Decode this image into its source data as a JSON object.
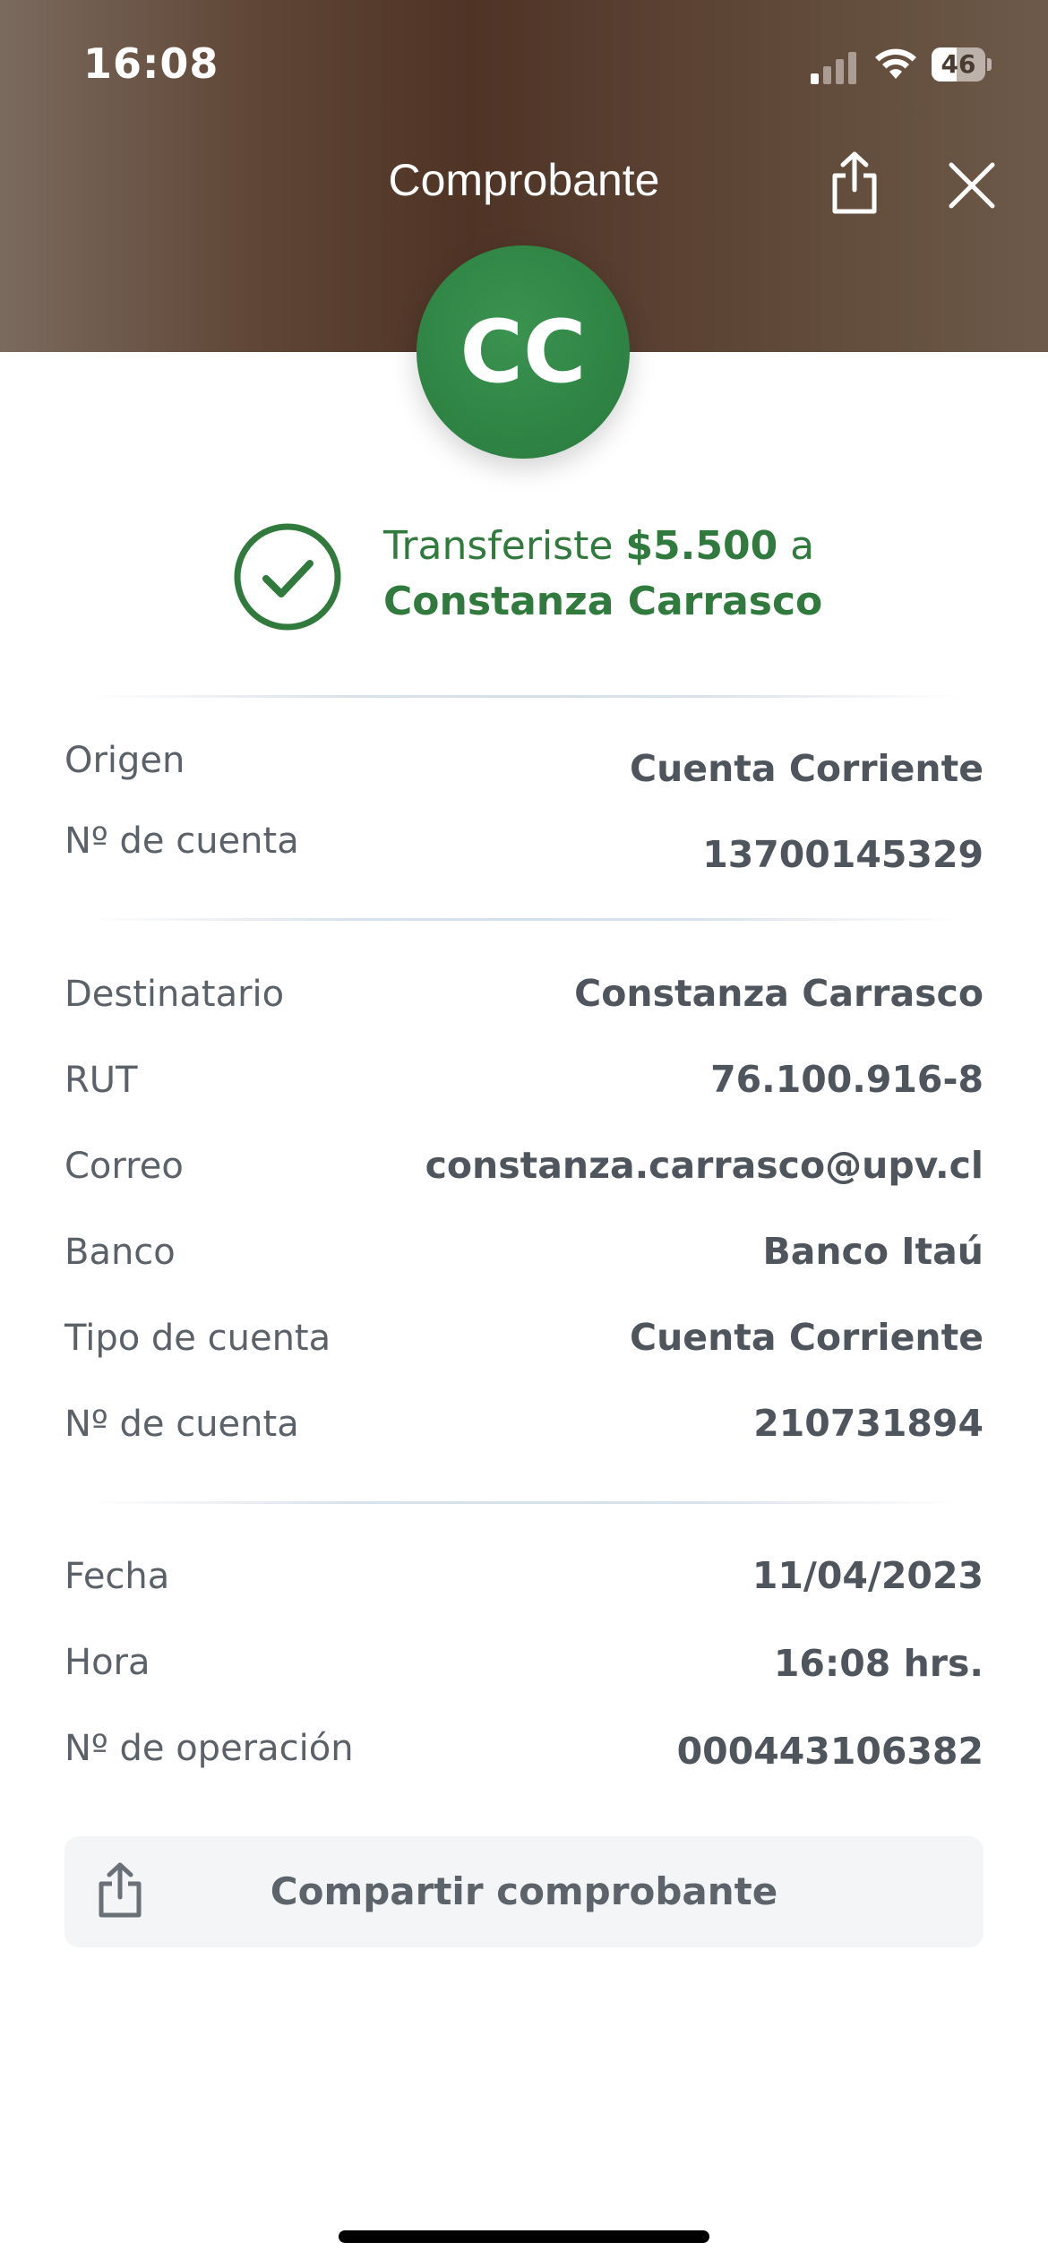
{
  "status_bar": {
    "time": "16:08",
    "battery_level": "46",
    "signal_bars_active": 1,
    "signal_bars_total": 4
  },
  "header": {
    "title": "Comprobante",
    "share_icon": "share-icon",
    "close_icon": "close-icon"
  },
  "avatar": {
    "initials": "CC",
    "color": "#2f8444"
  },
  "success": {
    "prefix": "Transferiste ",
    "amount": "$5.500",
    "suffix": " a",
    "recipient": "Constanza Carrasco",
    "icon": "check-circle-icon",
    "color": "#2f7a3c"
  },
  "origin": {
    "origen_label": "Origen",
    "origen_value": "Cuenta Corriente",
    "cuenta_label": "Nº de cuenta",
    "cuenta_value": "13700145329"
  },
  "recipient": {
    "destinatario_label": "Destinatario",
    "destinatario_value": "Constanza Carrasco",
    "rut_label": "RUT",
    "rut_value": "76.100.916-8",
    "correo_label": "Correo",
    "correo_value": "constanza.carrasco@upv.cl",
    "banco_label": "Banco",
    "banco_value": "Banco Itaú",
    "tipo_label": "Tipo de cuenta",
    "tipo_value": "Cuenta Corriente",
    "cuenta_label": "Nº de cuenta",
    "cuenta_value": "210731894"
  },
  "operation": {
    "fecha_label": "Fecha",
    "fecha_value": "11/04/2023",
    "hora_label": "Hora",
    "hora_value": "16:08 hrs.",
    "operacion_label": "Nº de operación",
    "operacion_value": "000443106382"
  },
  "share_button": {
    "label": "Compartir comprobante",
    "icon": "share-icon"
  }
}
